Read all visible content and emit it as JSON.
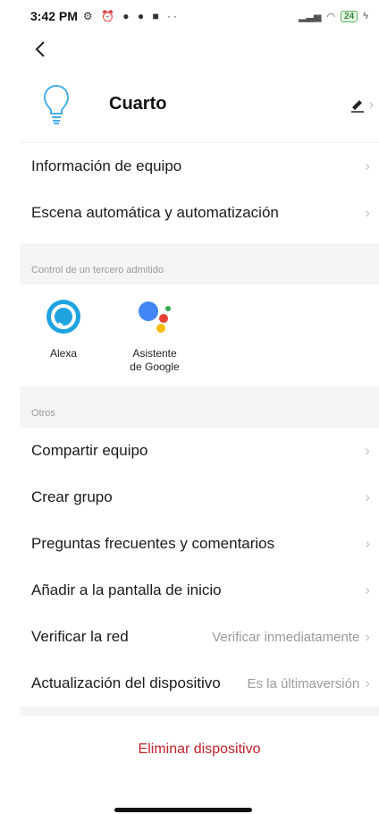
{
  "status_bar": {
    "time": "3:42 PM",
    "icons": [
      "settings-icon",
      "alarm-icon",
      "messenger-icon",
      "spotify-icon",
      "video-icon"
    ],
    "battery": "24"
  },
  "device": {
    "name": "Cuarto",
    "icon": "bulb-icon"
  },
  "section1": [
    {
      "label": "Información de equipo"
    },
    {
      "label": "Escena automática y automatización"
    }
  ],
  "third_party": {
    "header": "Control de un tercero admitido",
    "items": [
      {
        "label": "Alexa",
        "icon": "alexa-icon"
      },
      {
        "label": "Asistente de Google",
        "icon": "google-assistant-icon"
      }
    ]
  },
  "others": {
    "header": "Otros",
    "items": [
      {
        "label": "Compartir equipo",
        "value": ""
      },
      {
        "label": "Crear grupo",
        "value": ""
      },
      {
        "label": "Preguntas frecuentes y comentarios",
        "value": ""
      },
      {
        "label": "Añadir a la pantalla de inicio",
        "value": ""
      },
      {
        "label": "Verificar la red",
        "value": "Verificar inmediatamente"
      },
      {
        "label": "Actualización del dispositivo",
        "value": "Es la últimaversión"
      }
    ]
  },
  "delete_label": "Eliminar dispositivo",
  "colors": {
    "delete": "#c0222a",
    "bulb": "#4aaee8",
    "section_bg": "#f4f4f6"
  }
}
